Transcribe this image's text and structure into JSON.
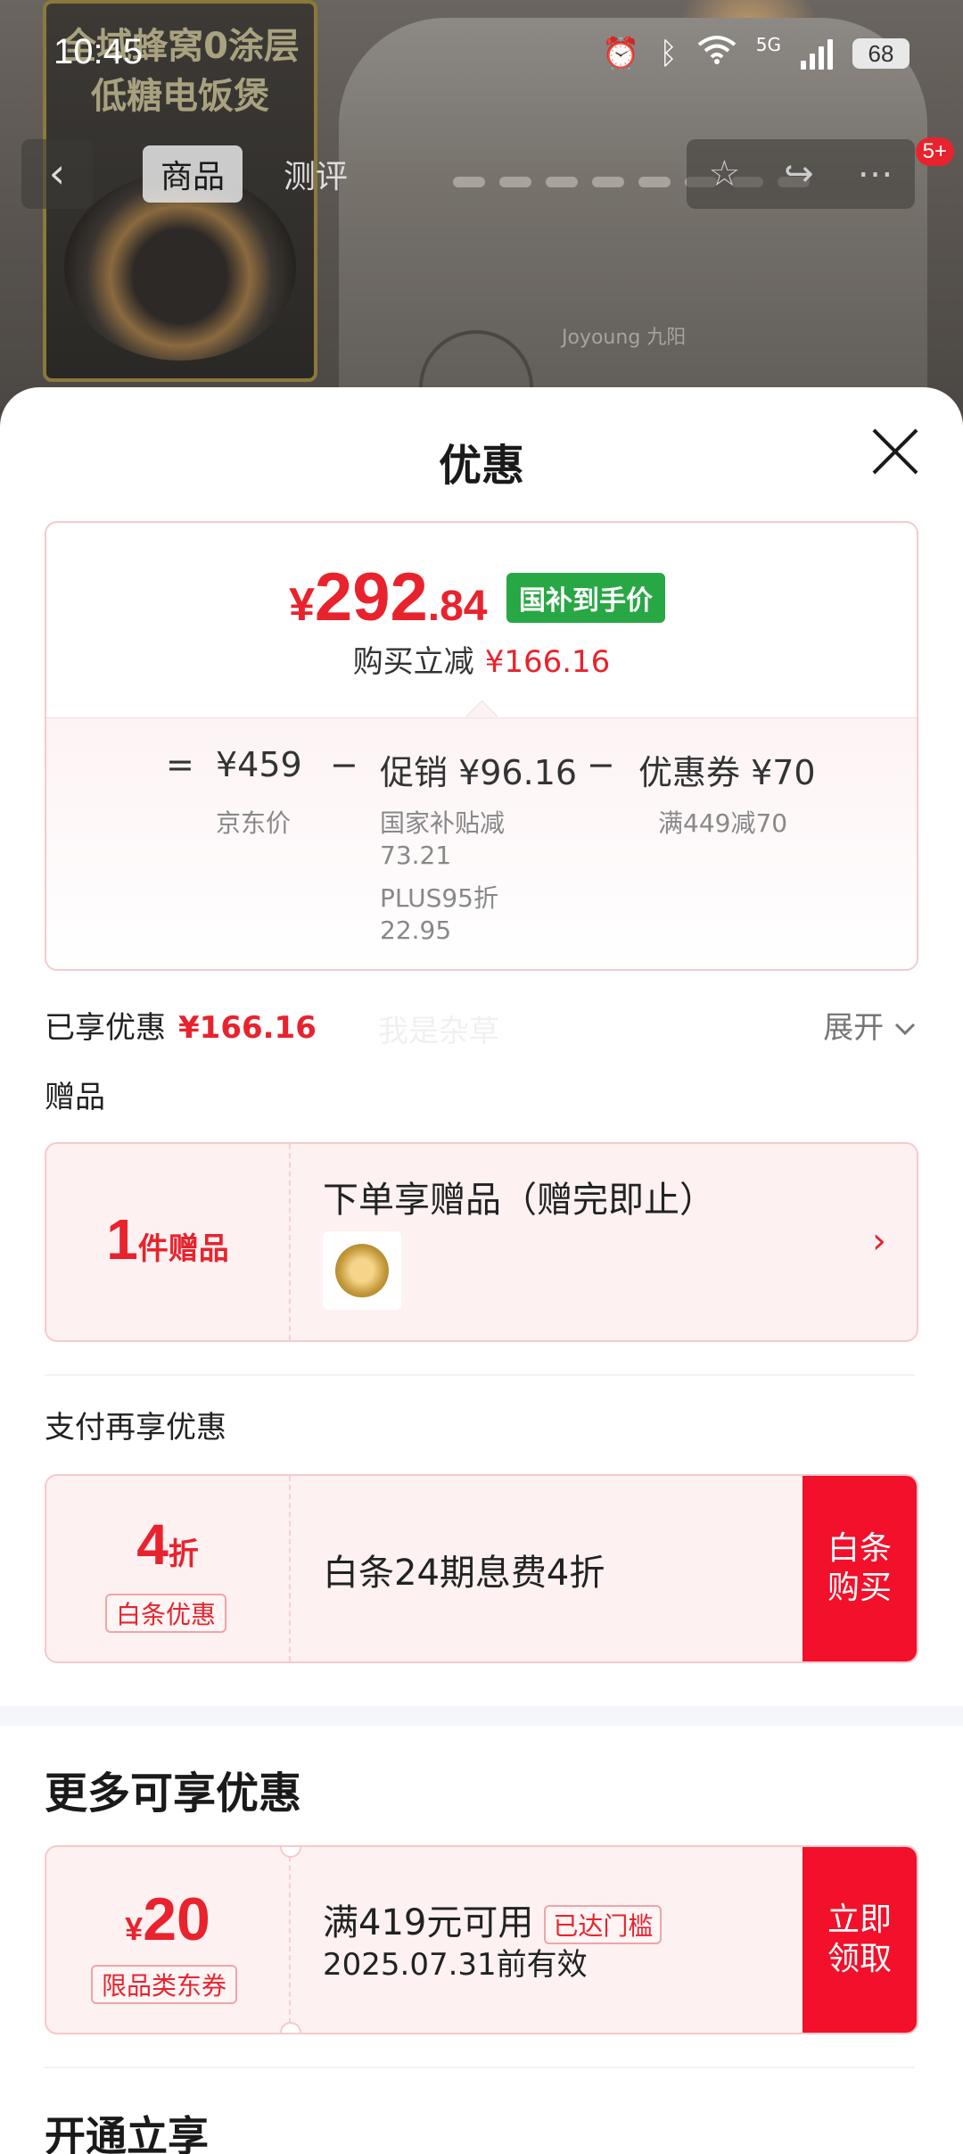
{
  "status_bar": {
    "time": "10:45",
    "network": "5G",
    "battery": "68"
  },
  "background": {
    "promo_text_line1": "全域蜂窝0涂层",
    "promo_text_line2": "低糖电饭煲",
    "brand": "Joyoung 九阳"
  },
  "nav": {
    "back_icon": "chevron-left-icon",
    "tabs": [
      {
        "label": "商品",
        "active": true
      },
      {
        "label": "测评",
        "active": false
      }
    ],
    "badge": "5+"
  },
  "sheet": {
    "title": "优惠"
  },
  "price_card": {
    "price_yen": "¥",
    "price_int": "292",
    "price_dec": ".84",
    "subsidy_tag": "国补到手价",
    "reduce_label": "购买立减",
    "reduce_amount": "¥166.16",
    "formula": {
      "eq": "=",
      "jd_price": "¥459",
      "jd_label": "京东价",
      "minus1": "−",
      "promo": "促销 ¥96.16",
      "promo_detail1_a": "国家补贴减",
      "promo_detail1_b": "73.21",
      "promo_detail2_a": "PLUS95折",
      "promo_detail2_b": "22.95",
      "minus2": "−",
      "coupon": "优惠券 ¥70",
      "coupon_detail": "满449减70"
    }
  },
  "enjoyed": {
    "label": "已享优惠",
    "amount": "¥166.16",
    "watermark": "我是杂草",
    "expand": "展开"
  },
  "gift": {
    "section_label": "赠品",
    "count": "1",
    "count_unit": "件赠品",
    "title": "下单享赠品（赠完即止）"
  },
  "pay": {
    "section_label": "支付再享优惠",
    "discount": "4",
    "discount_unit": "折",
    "tag": "白条优惠",
    "text": "白条24期息费4折",
    "button_line1": "白条",
    "button_line2": "购买"
  },
  "more": {
    "title": "更多可享优惠"
  },
  "coupon": {
    "yen": "¥",
    "value": "20",
    "tag": "限品类东券",
    "condition": "满419元可用",
    "met_tag": "已达门槛",
    "validity": "2025.07.31前有效",
    "button_line1": "立即",
    "button_line2": "领取"
  },
  "open": {
    "title": "开通立享"
  },
  "colors": {
    "accent_red": "#e8232d",
    "button_red": "#f2102a",
    "subsidy_green": "#28a745"
  }
}
